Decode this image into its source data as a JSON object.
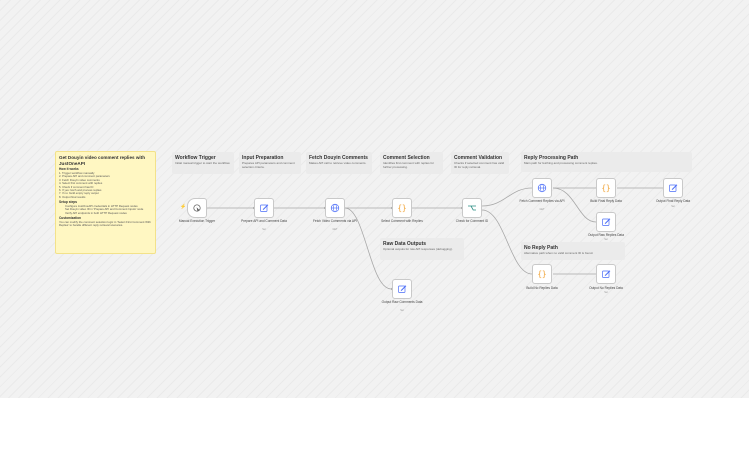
{
  "main_note": {
    "title": "Get Douyin video comment replies with JustOneAPI",
    "how_it_works_heading": "How it works",
    "how_it_works": [
      "1. Trigger workflow manually",
      "2. Prepare API and comment parameters",
      "3. Fetch Douyin video comments",
      "4. Select first comment with replies",
      "5. Check if comment has ID",
      "6. If yes: fetch and process replies",
      "7. If no: build empty reply output",
      "8. Output final results"
    ],
    "setup_heading": "Setup steps",
    "setup_steps": [
      "Configure JustOneAPI credentials in HTTP Request nodes",
      "Set Douyin video ID in 'Prepare API and Comment Inputs' node",
      "Verify API endpoints in both HTTP Request nodes"
    ],
    "customization_heading": "Customization",
    "customization_text": "You can modify the comment selection logic in 'Select First Comment With Replies' to handle different reply retrieval scenarios."
  },
  "stickies": {
    "trigger": {
      "title": "Workflow Trigger",
      "desc": "Initial manual trigger to start the workflow."
    },
    "input": {
      "title": "Input Preparation",
      "desc": "Prepares API parameters and comment selection criteria."
    },
    "fetch": {
      "title": "Fetch Douyin Comments",
      "desc": "Makes API call to retrieve video comments."
    },
    "selection": {
      "title": "Comment Selection",
      "desc": "Identifies first comment with replies for further processing."
    },
    "validation": {
      "title": "Comment Validation",
      "desc": "Checks if selected comment has valid ID for reply retrieval."
    },
    "reply": {
      "title": "Reply Processing Path",
      "desc": "Main path for fetching and processing comment replies."
    },
    "raw": {
      "title": "Raw Data Outputs",
      "desc": "Optional outputs for raw API responses (debugging)."
    },
    "noreply": {
      "title": "No Reply Path",
      "desc": "Alternative path when no valid comment ID is found."
    }
  },
  "nodes": {
    "manual": {
      "label": "Manual Execution Trigger",
      "icon": "pointer-icon"
    },
    "prepare": {
      "label": "Prepare API and Comment Data",
      "sub": "Set",
      "icon": "edit-icon"
    },
    "fetch_comments": {
      "label": "Fetch Video Comments via API",
      "sub": "GET",
      "icon": "globe-icon"
    },
    "select_comment": {
      "label": "Select Comment with Replies",
      "icon": "code-braces-icon"
    },
    "check_id": {
      "label": "Check for Comment ID",
      "icon": "if-branch-icon"
    },
    "fetch_replies": {
      "label": "Fetch Comment Replies via API",
      "sub": "GET",
      "icon": "globe-icon"
    },
    "build_final": {
      "label": "Build Final Reply Data",
      "icon": "code-braces-icon"
    },
    "output_final": {
      "label": "Output Final Reply Data",
      "sub": "Set",
      "icon": "edit-icon"
    },
    "output_raw_replies": {
      "label": "Output Raw Replies Data",
      "sub": "Set",
      "icon": "edit-icon"
    },
    "output_raw_comments": {
      "label": "Output Raw Comments Data",
      "sub": "Set",
      "icon": "edit-icon"
    },
    "build_no_replies": {
      "label": "Build No Replies Data",
      "icon": "code-braces-icon"
    },
    "output_no_replies": {
      "label": "Output No Replies Data",
      "sub": "Set",
      "icon": "edit-icon"
    }
  },
  "colors": {
    "edge": "#a8a8a8",
    "icon_blue": "#4a6cf7",
    "icon_orange": "#f0a030",
    "icon_teal": "#2a8c82",
    "note_yellow": "#fff7c2"
  }
}
